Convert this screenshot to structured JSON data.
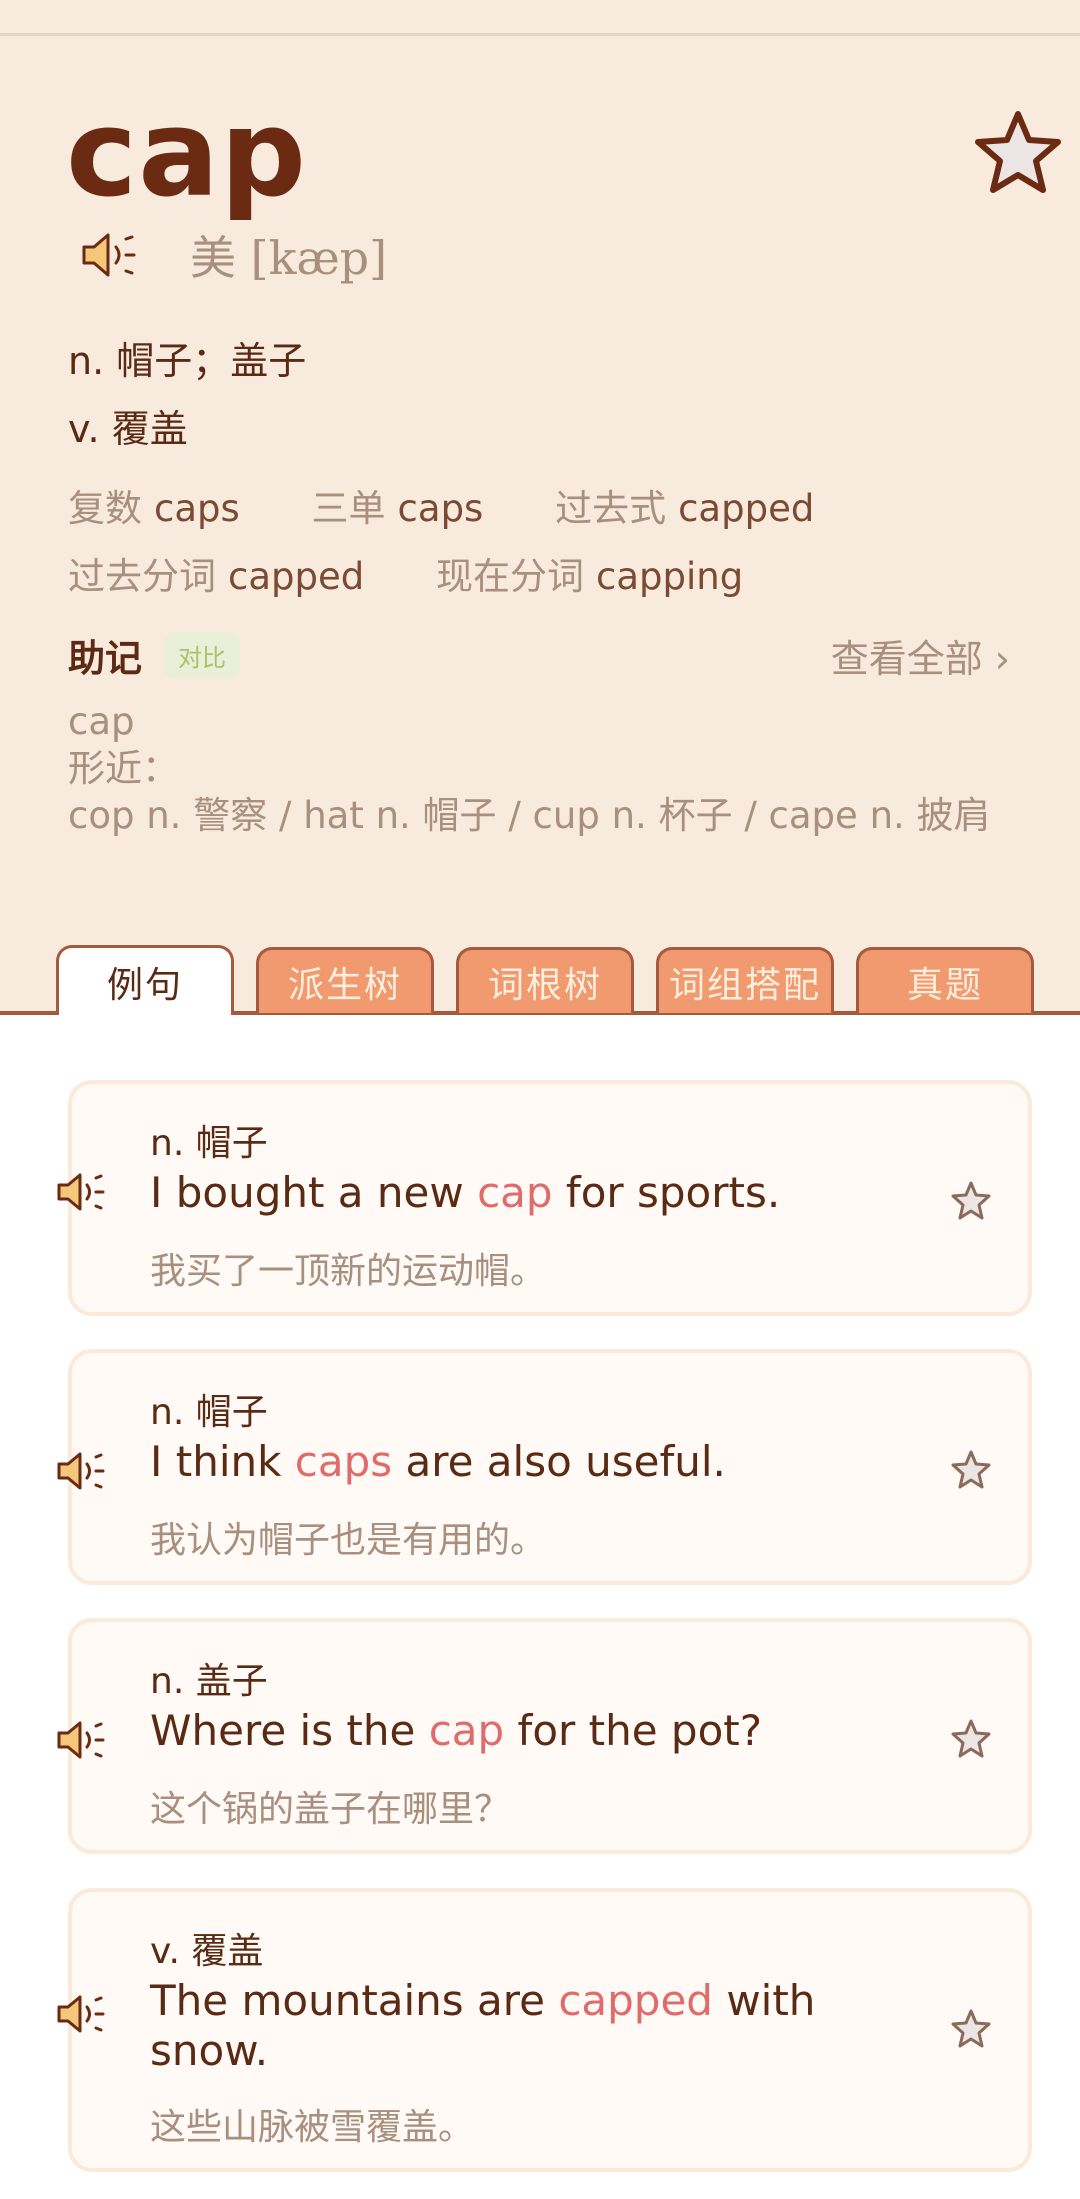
{
  "word": "cap",
  "phonetic": "美 [kæp]",
  "definitions": [
    "n. 帽子；盖子",
    "v. 覆盖"
  ],
  "forms_row1": [
    {
      "label": "复数",
      "value": "caps"
    },
    {
      "label": "三单",
      "value": "caps"
    },
    {
      "label": "过去式",
      "value": "capped"
    }
  ],
  "forms_row2": [
    {
      "label": "过去分词",
      "value": "capped"
    },
    {
      "label": "现在分词",
      "value": "capping"
    }
  ],
  "mnemonic": {
    "title": "助记",
    "badge": "对比",
    "view_all": "查看全部 ›",
    "line1": "cap",
    "line2": "形近：",
    "line3": "cop n. 警察 / hat n. 帽子 / cup n. 杯子 / cape n. 披肩"
  },
  "tabs": [
    "例句",
    "派生树",
    "词根树",
    "词组搭配",
    "真题"
  ],
  "examples": [
    {
      "pos": "n. 帽子",
      "en_before": "I bought a new ",
      "en_hl": "cap",
      "en_after": " for sports.",
      "zh": "我买了一顶新的运动帽。"
    },
    {
      "pos": "n. 帽子",
      "en_before": "I think ",
      "en_hl": "caps",
      "en_after": " are also useful.",
      "zh": "我认为帽子也是有用的。"
    },
    {
      "pos": "n. 盖子",
      "en_before": "Where is the ",
      "en_hl": "cap",
      "en_after": " for the pot?",
      "zh": "这个锅的盖子在哪里？"
    },
    {
      "pos": "v. 覆盖",
      "en_before": "The mountains are ",
      "en_hl": "capped",
      "en_after": " with snow.",
      "zh": "这些山脉被雪覆盖。"
    }
  ],
  "colors": {
    "accent": "#e06b6b",
    "tab": "#f29a6f",
    "brown": "#5a2a14"
  }
}
